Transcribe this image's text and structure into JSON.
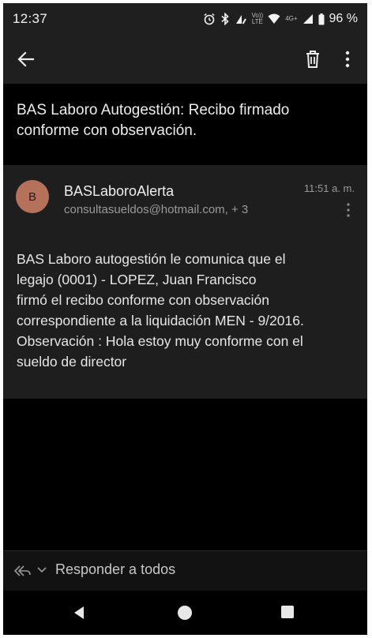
{
  "status_bar": {
    "time": "12:37",
    "volte_top": "Vo))",
    "volte_bottom": "LTE",
    "network": "4G+",
    "battery": "96 %"
  },
  "toolbar": {
    "back_icon": "arrow-left-icon",
    "delete_icon": "trash-icon",
    "more_icon": "more-vertical-icon"
  },
  "email": {
    "subject": "BAS Laboro Autogestión: Recibo firmado conforme con observación.",
    "sender": {
      "avatar_letter": "B",
      "avatar_color": "#b5715a",
      "name": "BASLaboroAlerta",
      "email": "consultasueldos@hotmail.com, + 3"
    },
    "time": "11:51 a. m.",
    "body": {
      "line1": "BAS Laboro autogestión le comunica que el",
      "line2": "legajo (0001) -  LOPEZ, Juan Francisco",
      "line3": "firmó el recibo conforme con observación",
      "line4": "correspondiente a la liquidación MEN - 9/2016.",
      "line5": "Observación : Hola estoy muy conforme con el",
      "line6": "sueldo de director"
    }
  },
  "reply_bar": {
    "label": "Responder a todos",
    "icon": "reply-all-icon"
  },
  "nav_bar": {
    "back_icon": "nav-back-icon",
    "home_icon": "nav-home-icon",
    "recents_icon": "nav-recents-icon"
  }
}
